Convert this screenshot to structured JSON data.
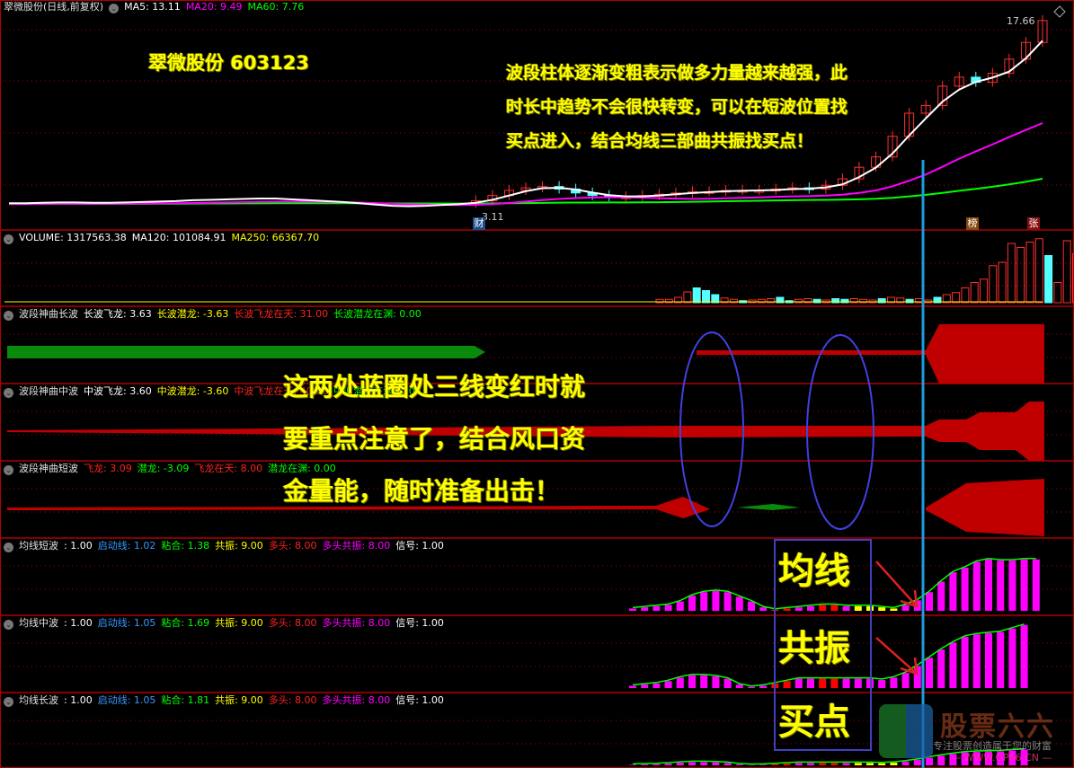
{
  "headers": {
    "main": {
      "title": "翠微股份(日线,前复权)",
      "items": [
        {
          "label": "MA5: 13.11",
          "color": "#ffffff"
        },
        {
          "label": "MA20: 9.49",
          "color": "#ff00ff"
        },
        {
          "label": "MA60: 7.76",
          "color": "#00ff00"
        }
      ]
    },
    "volume": {
      "items": [
        {
          "label": "VOLUME: 1317563.38",
          "color": "#ffffff"
        },
        {
          "label": "MA120: 101084.91",
          "color": "#ffffff"
        },
        {
          "label": "MA250: 66367.70",
          "color": "#ffff00"
        }
      ]
    },
    "long_wave": {
      "title": "波段神曲长波",
      "items": [
        {
          "label": "长波飞龙: 3.63",
          "color": "#ffffff"
        },
        {
          "label": "长波潜龙: -3.63",
          "color": "#ffff00"
        },
        {
          "label": "长波飞龙在天: 31.00",
          "color": "#ff2020"
        },
        {
          "label": "长波潜龙在渊: 0.00",
          "color": "#00ff00"
        }
      ]
    },
    "mid_wave": {
      "title": "波段神曲中波",
      "items": [
        {
          "label": "中波飞龙: 3.60",
          "color": "#ffffff"
        },
        {
          "label": "中波潜龙: -3.60",
          "color": "#ffff00"
        },
        {
          "label": "中波飞龙在天: 40.00",
          "color": "#ff2020"
        },
        {
          "label": "中波潜龙在渊: 0.00",
          "color": "#00ff00"
        }
      ]
    },
    "short_wave": {
      "title": "波段神曲短波",
      "items": [
        {
          "label": "飞龙: 3.09",
          "color": "#ff2020"
        },
        {
          "label": "潜龙: -3.09",
          "color": "#00ff00"
        },
        {
          "label": "飞龙在天: 8.00",
          "color": "#ff2020"
        },
        {
          "label": "潜龙在渊: 0.00",
          "color": "#00ff00"
        }
      ]
    },
    "ma_short": {
      "title": "均线短波",
      "items": [
        {
          "label": ": 1.00",
          "color": "#ffffff"
        },
        {
          "label": "启动线: 1.02",
          "color": "#3399ff"
        },
        {
          "label": "粘合: 1.38",
          "color": "#00ff00"
        },
        {
          "label": "共振: 9.00",
          "color": "#ffff00"
        },
        {
          "label": "多头: 8.00",
          "color": "#ff2020"
        },
        {
          "label": "多头共振: 8.00",
          "color": "#ff00ff"
        },
        {
          "label": "信号: 1.00",
          "color": "#ffffff"
        }
      ]
    },
    "ma_mid": {
      "title": "均线中波",
      "items": [
        {
          "label": ": 1.00",
          "color": "#ffffff"
        },
        {
          "label": "启动线: 1.05",
          "color": "#3399ff"
        },
        {
          "label": "粘合: 1.69",
          "color": "#00ff00"
        },
        {
          "label": "共振: 9.00",
          "color": "#ffff00"
        },
        {
          "label": "多头: 8.00",
          "color": "#ff2020"
        },
        {
          "label": "多头共振: 8.00",
          "color": "#ff00ff"
        },
        {
          "label": "信号: 1.00",
          "color": "#ffffff"
        }
      ]
    },
    "ma_long": {
      "title": "均线长波",
      "items": [
        {
          "label": ": 1.00",
          "color": "#ffffff"
        },
        {
          "label": "启动线: 1.05",
          "color": "#3399ff"
        },
        {
          "label": "粘合: 1.81",
          "color": "#00ff00"
        },
        {
          "label": "共振: 9.00",
          "color": "#ffff00"
        },
        {
          "label": "多头: 8.00",
          "color": "#ff2020"
        },
        {
          "label": "多头共振: 8.00",
          "color": "#ff00ff"
        },
        {
          "label": "信号: 1.00",
          "color": "#ffffff"
        }
      ]
    }
  },
  "annotations": {
    "stock": "翠微股份 603123",
    "top_lines": [
      "波段柱体逐渐变粗表示做多力量越来越强，此",
      "时长中趋势不会很快转变，可以在短波位置找",
      "买点进入，结合均线三部曲共振找买点！"
    ],
    "mid_lines": [
      "这两处蓝圈处三线变红时就",
      "要重点注意了，结合风口资",
      "金量能，随时准备出击！"
    ],
    "side_labels": [
      "均线",
      "共振",
      "买点"
    ]
  },
  "markers": {
    "high_price": "17.66",
    "low_price": "3.11",
    "tag_cai": "财",
    "tag_bang": "榜",
    "tag_zhang": "张"
  },
  "watermark": {
    "name": "股票六六",
    "slogan": "专注股票创造属于您的财富",
    "url": "— WWW.GP66.CN —"
  },
  "chart_data": {
    "type": "line",
    "title": "翠微股份(日线,前复权)",
    "colors": {
      "up": "#ff3030",
      "down": "#54ffff",
      "ma5": "#ffffff",
      "ma20": "#ff00ff",
      "ma60": "#00ff00",
      "cursor": "#1e9be0",
      "grid": "#b00000"
    },
    "close_series": [
      3.4,
      3.4,
      3.5,
      3.5,
      3.4,
      3.4,
      3.5,
      3.5,
      3.5,
      3.6,
      3.6,
      3.7,
      3.7,
      3.7,
      3.8,
      3.8,
      3.7,
      3.6,
      3.6,
      3.5,
      3.4,
      3.3,
      3.2,
      3.1,
      3.2,
      3.3,
      3.3,
      3.4,
      3.6,
      4.0,
      4.4,
      4.6,
      4.7,
      4.5,
      4.2,
      4.0,
      3.9,
      3.9,
      4.0,
      4.1,
      4.2,
      4.3,
      4.3,
      4.4,
      4.4,
      4.4,
      4.5,
      4.6,
      4.5,
      4.8,
      5.3,
      6.2,
      7.0,
      8.6,
      10.4,
      11.0,
      12.5,
      13.2,
      12.8,
      13.5,
      14.6,
      15.9,
      17.6
    ],
    "ma_short_values": [
      0.2,
      0.3,
      0.4,
      0.5,
      0.8,
      1.3,
      1.6,
      1.7,
      1.6,
      1.2,
      0.8,
      0.3,
      0.1,
      0.2,
      0.3,
      0.4,
      0.5,
      0.5,
      0.4,
      0.4,
      0.4,
      0.3,
      0.2,
      0.5,
      0.9,
      1.6,
      2.5,
      3.3,
      3.7,
      4.2,
      4.4,
      4.3,
      4.3,
      4.4,
      4.4
    ],
    "ma_mid_values": [
      0.2,
      0.3,
      0.4,
      0.6,
      0.9,
      1.1,
      1.1,
      1.0,
      0.8,
      0.3,
      0.1,
      0.2,
      0.4,
      0.6,
      0.8,
      0.8,
      0.8,
      0.8,
      0.8,
      0.8,
      0.8,
      0.7,
      0.9,
      1.3,
      1.9,
      2.6,
      3.3,
      3.9,
      4.4,
      4.6,
      4.7,
      4.8,
      5.1,
      5.4
    ]
  }
}
